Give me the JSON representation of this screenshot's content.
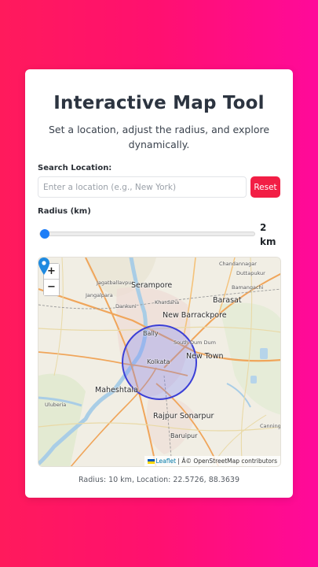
{
  "header": {
    "title": "Interactive Map Tool",
    "subtitle": "Set a location, adjust the radius, and explore dynamically."
  },
  "search": {
    "label": "Search Location:",
    "placeholder": "Enter a location (e.g., New York)",
    "value": "",
    "reset_label": "Reset"
  },
  "radius": {
    "label": "Radius (km)",
    "value": "2",
    "unit": "km",
    "slider_fraction": 0.02
  },
  "map": {
    "zoom_in": "+",
    "zoom_out": "−",
    "attribution_leaflet": "Leaflet",
    "attribution_rest": " | Â© OpenStreetMap contributors",
    "places": {
      "serampore": "Serampore",
      "barasat": "Barasat",
      "new_barrackpore": "New Barrackpore",
      "bally": "Bally",
      "kolkata": "Kolkata",
      "new_town": "New Town",
      "maheshtala": "Maheshtala",
      "rajpur_sonarpur": "Rajpur Sonarpur",
      "baruipur": "Baruipur",
      "uluberia": "Uluberia",
      "chandannagar": "Chandannagar",
      "dankuni": "Dankuni",
      "khardaha": "Khardaha",
      "duttapukur": "Duttapukur",
      "bamangachi": "Bamangachi",
      "jangalpara": "Jangalpara",
      "jagatballavpur": "Jagatballavpur",
      "south_dum_dum": "South Dum Dum",
      "canning": "Canning II"
    },
    "colors": {
      "circle_stroke": "#3b3fd6",
      "circle_fill": "#6f7cff",
      "pin": "#1f8ae0"
    }
  },
  "footer": {
    "status": "Radius: 10 km, Location: 22.5726, 88.3639"
  },
  "colors": {
    "accent": "#f21e45",
    "slider": "#1e7ef7"
  }
}
